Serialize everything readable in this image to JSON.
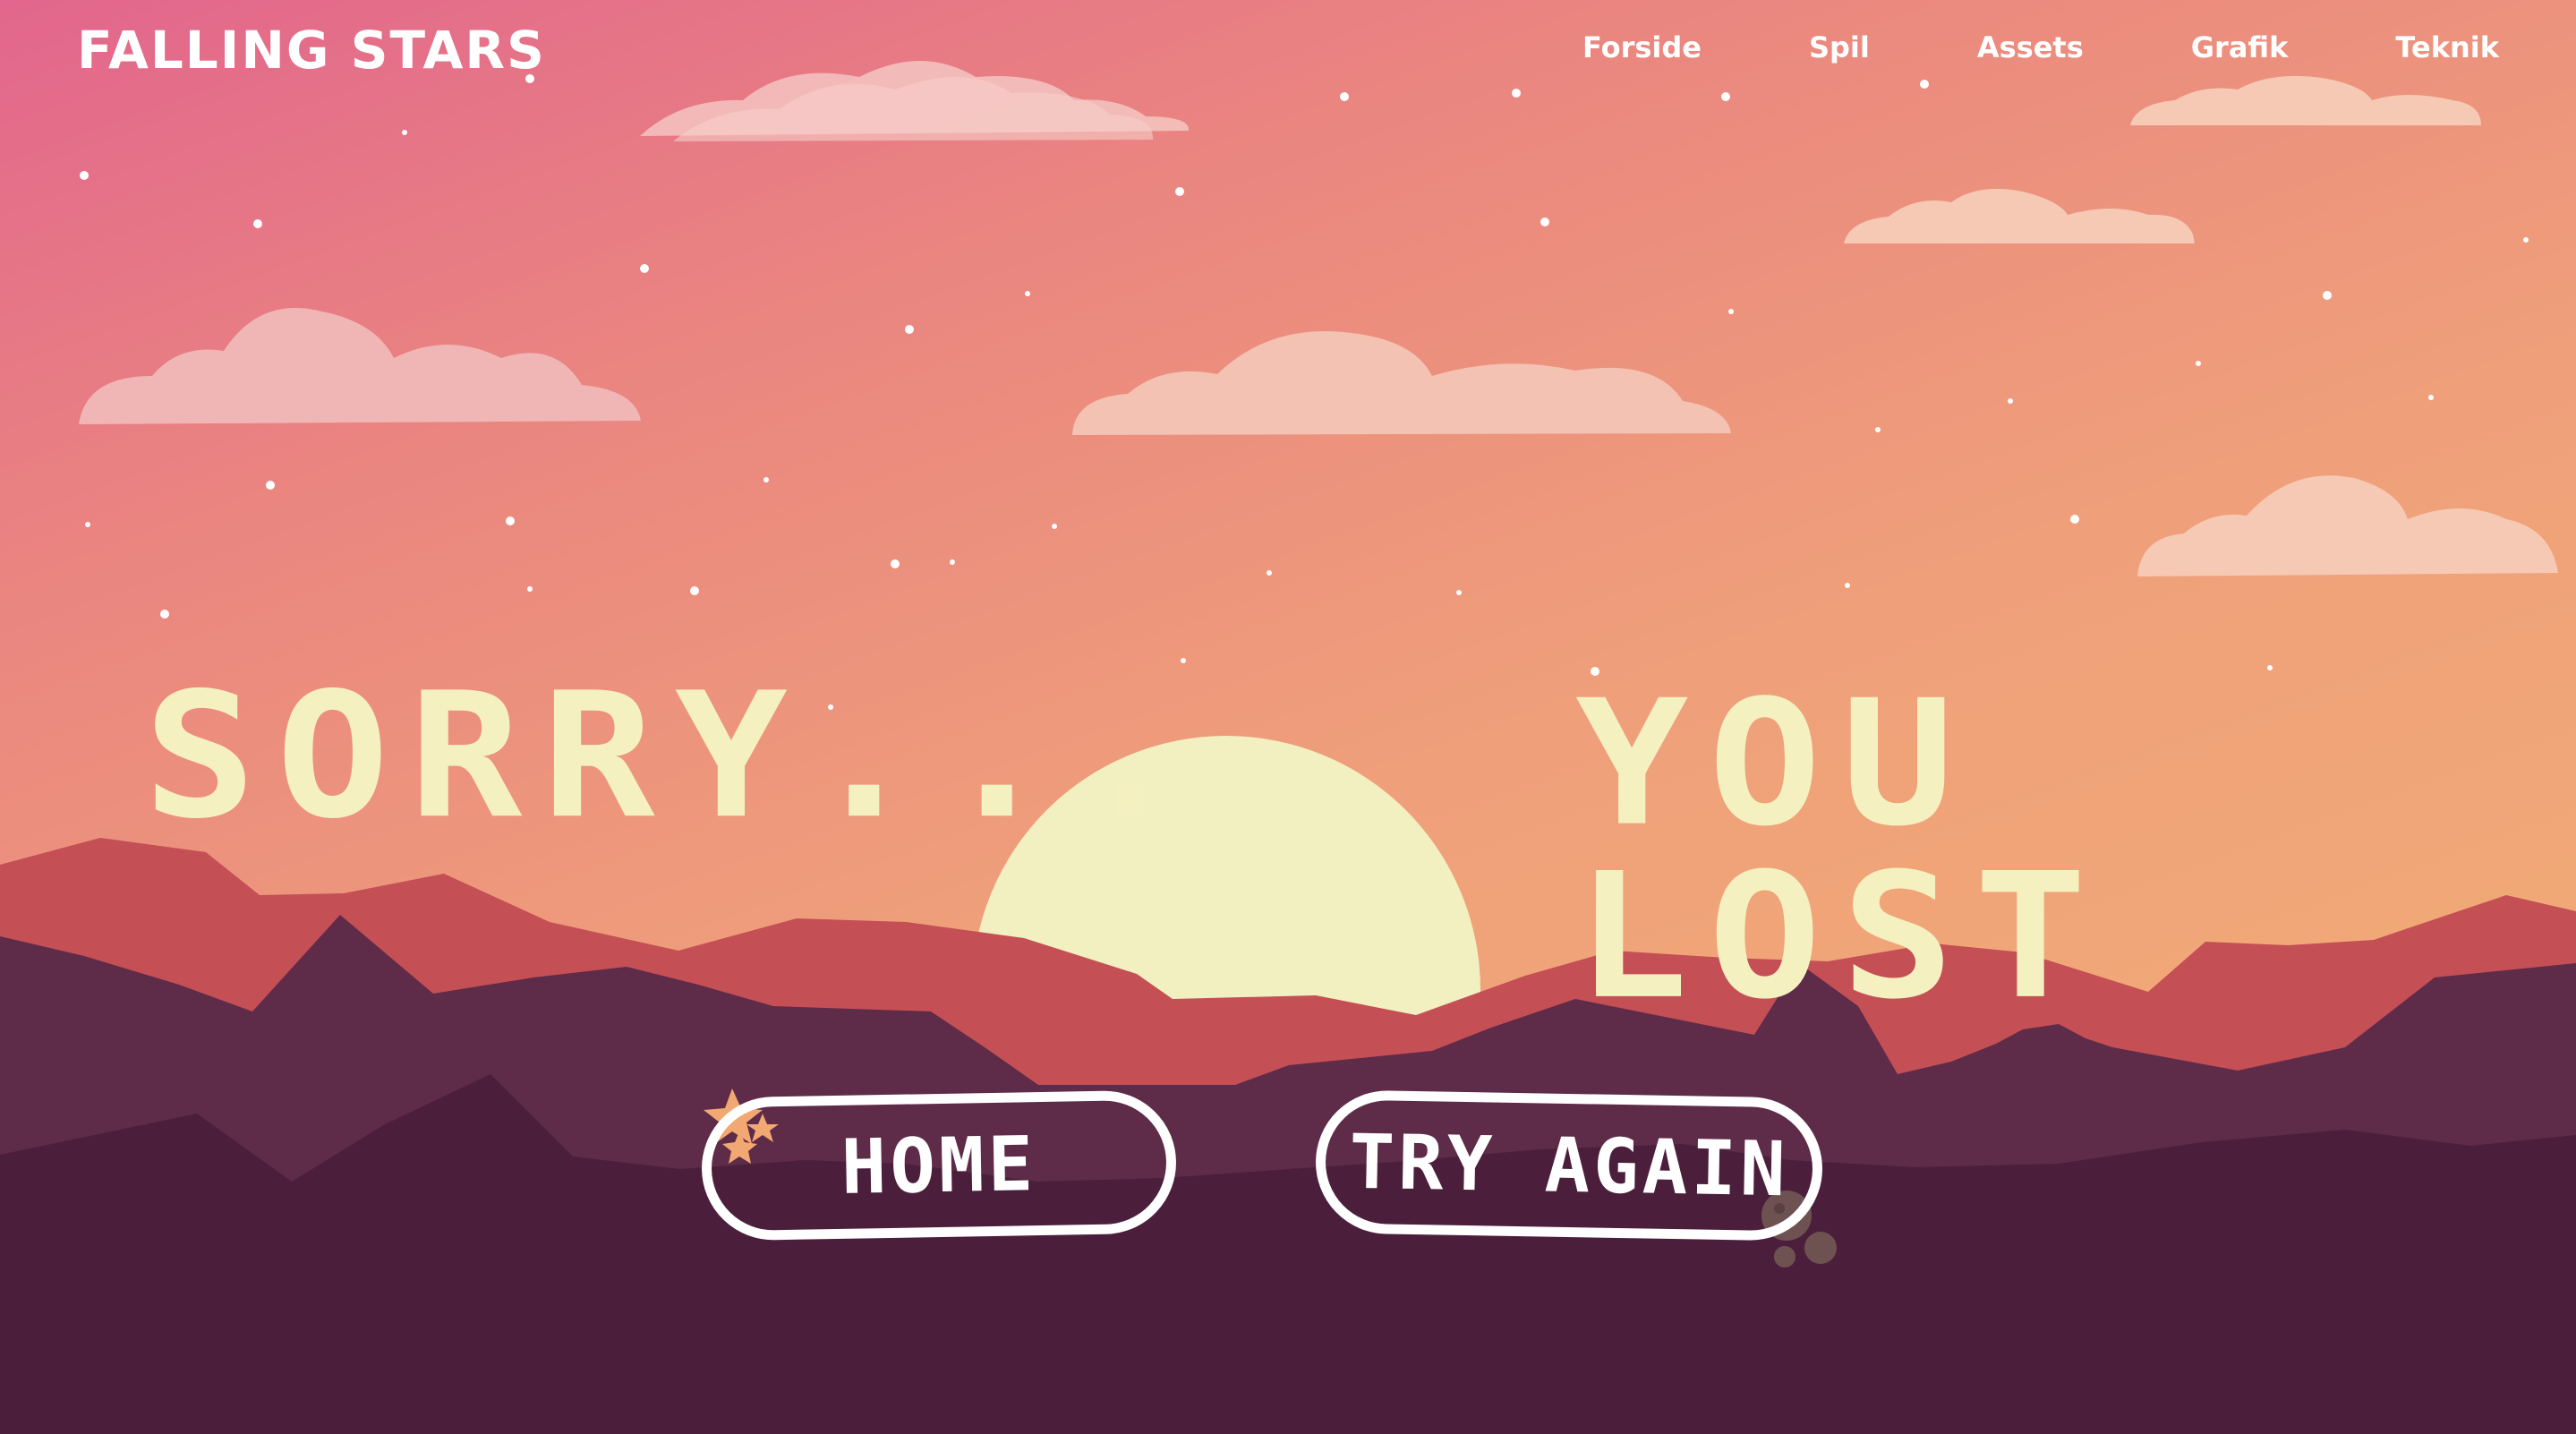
{
  "header": {
    "logo": "FALLING STARS",
    "nav": [
      "Forside",
      "Spil",
      "Assets",
      "Grafik",
      "Teknik"
    ]
  },
  "main": {
    "headline_left": "SORRY...",
    "headline_right": "YOU LOST",
    "home_button": "HOME",
    "try_again_button": "TRY AGAIN"
  },
  "colors": {
    "sky_top": "#e2668d",
    "sky_bottom": "#f3b074",
    "sun": "#f2efc0",
    "mountain_red": "#c44f55",
    "mountain_plum": "#5e2b48",
    "ground": "#4b1f3b",
    "headline": "#f4f0c0",
    "cloud": "#f3c3bd"
  }
}
